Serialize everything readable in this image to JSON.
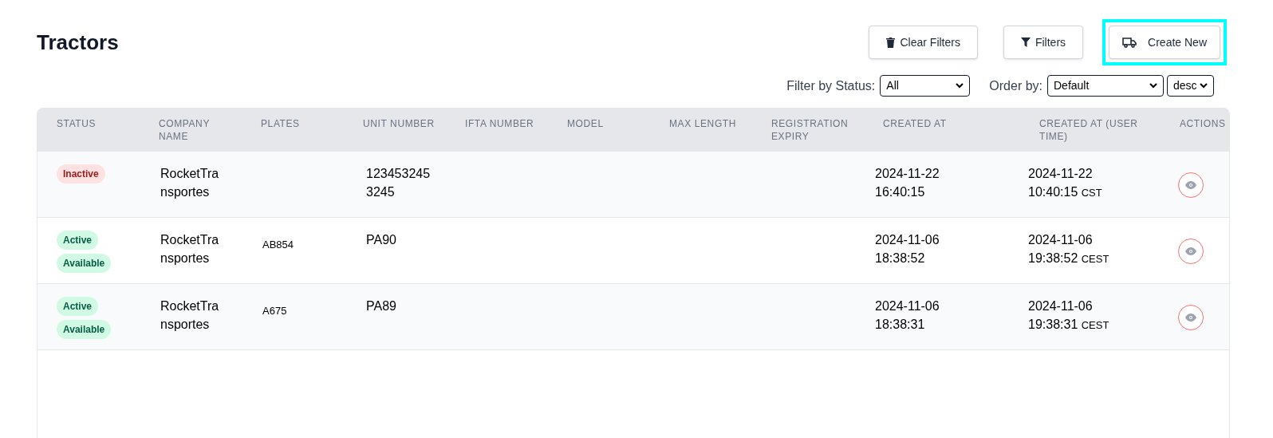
{
  "title": "Tractors",
  "toolbar": [
    {
      "kind": "clear",
      "label": "Clear Filters",
      "highlighted": false
    },
    {
      "kind": "filter",
      "label": "Filters",
      "highlighted": false
    },
    {
      "kind": "create",
      "label": "Create New",
      "highlighted": true
    }
  ],
  "filters": [
    {
      "label": "Filter by Status:",
      "selects": [
        {
          "value": "All"
        }
      ]
    },
    {
      "label": "Order by:",
      "selects": [
        {
          "value": "Default"
        },
        {
          "value": "desc"
        }
      ]
    }
  ],
  "table": {
    "columns": [
      "STATUS",
      "COMPANY NAME",
      "PLATES",
      "UNIT NUMBER",
      "IFTA NUMBER",
      "MODEL",
      "MAX LENGTH",
      "REGISTRATION EXPIRY",
      "CREATED AT",
      "CREATED AT (USER TIME)",
      "ACTIONS"
    ],
    "rows": [
      {
        "badges": [
          {
            "label": "Inactive",
            "kind": "inactive"
          }
        ],
        "company": "RocketTransportes",
        "plates": "",
        "unit": "1234532453245",
        "created_at": "2024-11-22 16:40:15",
        "user_time": "2024-11-22 10:40:15",
        "timezone": "CST"
      },
      {
        "badges": [
          {
            "label": "Active",
            "kind": "active"
          },
          {
            "label": "Available",
            "kind": "active"
          }
        ],
        "company": "RocketTransportes",
        "plates": "AB854",
        "unit": "PA90",
        "created_at": "2024-11-06 18:38:52",
        "user_time": "2024-11-06 19:38:52",
        "timezone": "CEST"
      },
      {
        "badges": [
          {
            "label": "Active",
            "kind": "active"
          },
          {
            "label": "Available",
            "kind": "active"
          }
        ],
        "company": "RocketTransportes",
        "plates": "A675",
        "unit": "PA89",
        "created_at": "2024-11-06 18:38:31",
        "user_time": "2024-11-06 19:38:31",
        "timezone": "CEST"
      }
    ]
  }
}
